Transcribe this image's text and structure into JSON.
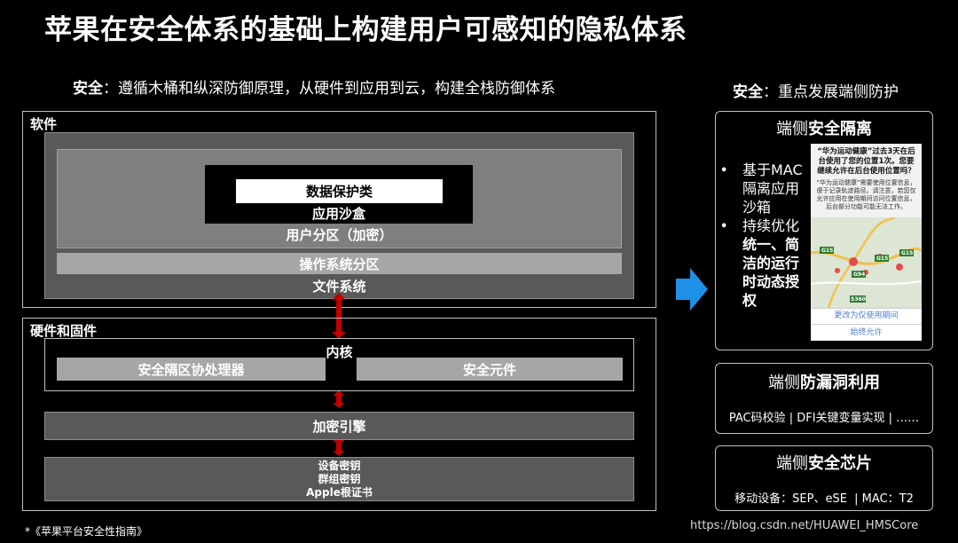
{
  "title": "苹果在安全体系的基础上构建用户可感知的隐私体系",
  "left_subtitle": {
    "bold": "安全",
    "rest": "：遵循木桶和纵深防御原理，从硬件到应用到云，构建全栈防御体系"
  },
  "right_subtitle": {
    "bold": "安全",
    "rest": "：重点发展端侧防护"
  },
  "software": {
    "label": "软件",
    "data_protection": "数据保护类",
    "app_sandbox": "应用沙盒",
    "user_partition": "用户分区（加密）",
    "os_partition": "操作系统分区",
    "file_system": "文件系统"
  },
  "hardware": {
    "label": "硬件和固件",
    "kernel": "内核",
    "secure_enclave": "安全隔区协处理器",
    "secure_element": "安全元件",
    "crypto_engine": "加密引擎",
    "keys": [
      "设备密钥",
      "群组密钥",
      "Apple根证书"
    ]
  },
  "footnote": "*《苹果平台安全性指南》",
  "watermark": "https://blog.csdn.net/HUAWEI_HMSCore",
  "cards": {
    "isolation": {
      "title_normal": "端侧",
      "title_bold": "安全隔离",
      "bullets": [
        {
          "normal": "基于MAC隔离应用沙箱",
          "bold": ""
        },
        {
          "normal": "持续优化",
          "bold": "统一、简洁的运行时动态授权"
        }
      ],
      "phone": {
        "prompt": "“华为运动健康”过去3天在后台使用了您的位置1次。您要继续允许在后台使用位置吗？",
        "detail": "“华为运动健康”需要使用位置信息，便于记录轨迹路径。请注意，若您仅允许应用在使用期间访问位置信息，后台部分功能可能无法工作。",
        "btn_change": "更改为仅使用期间",
        "btn_always": "始终允许",
        "road_labels": [
          "G15",
          "G15",
          "G15",
          "G94",
          "S360"
        ]
      }
    },
    "exploit": {
      "title_normal": "端侧",
      "title_bold": "防漏洞利用",
      "text": "PAC码校验 | DFI关键变量实现 | ……"
    },
    "chip": {
      "title_normal": "端侧",
      "title_bold": "安全芯片",
      "text": "移动设备：SEP、eSE  | MAC：T2"
    }
  },
  "colors": {
    "arrow_red": "#c00000",
    "arrow_blue": "#1e90e8",
    "panel_grey": "#595959",
    "bar_light": "#a6a6a6"
  }
}
